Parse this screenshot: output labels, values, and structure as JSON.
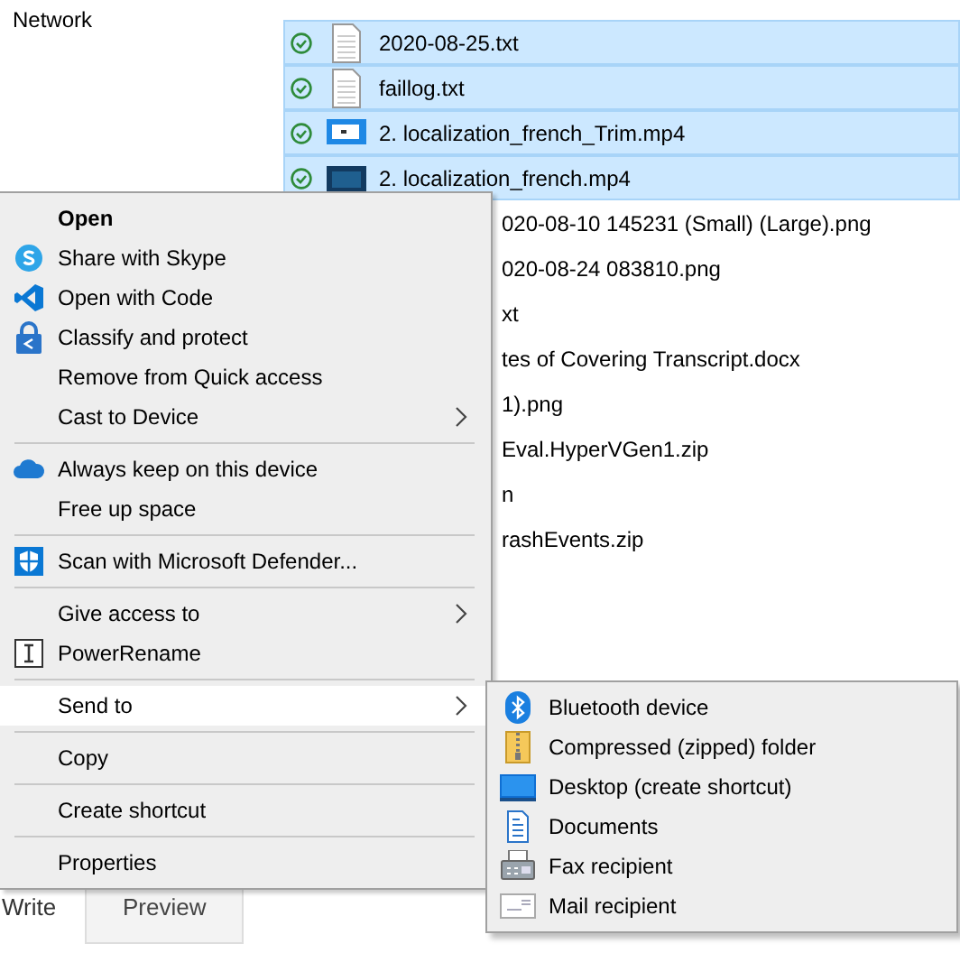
{
  "navigation": {
    "items": [
      {
        "label": "Network"
      }
    ]
  },
  "files": [
    {
      "name": "2020-08-25.txt",
      "kind": "full",
      "selected": true
    },
    {
      "name": "faillog.txt",
      "kind": "full",
      "selected": true
    },
    {
      "name": "2. localization_french_Trim.mp4",
      "kind": "full",
      "selected": true
    },
    {
      "name": "2. localization_french.mp4",
      "kind": "full",
      "selected": true
    },
    {
      "name": "020-08-10 145231 (Small) (Large).png",
      "kind": "partial",
      "selected": false
    },
    {
      "name": "020-08-24 083810.png",
      "kind": "partial",
      "selected": false
    },
    {
      "name": "xt",
      "kind": "partial",
      "selected": false
    },
    {
      "name": "tes of Covering Transcript.docx",
      "kind": "partial",
      "selected": false
    },
    {
      "name": "1).png",
      "kind": "partial",
      "selected": false
    },
    {
      "name": "Eval.HyperVGen1.zip",
      "kind": "partial",
      "selected": false
    },
    {
      "name": "n",
      "kind": "partial",
      "selected": false
    },
    {
      "name": "rashEvents.zip",
      "kind": "partial",
      "selected": false
    }
  ],
  "editor_tabs": [
    {
      "label": "Write",
      "selected": true
    },
    {
      "label": "Preview",
      "selected": false
    }
  ],
  "context_menu": {
    "items": [
      {
        "kind": "item",
        "label": "Open",
        "bold": true,
        "selected": false
      },
      {
        "kind": "item",
        "label": "Share with Skype",
        "selected": false
      },
      {
        "kind": "item",
        "label": "Open with Code",
        "selected": false
      },
      {
        "kind": "item",
        "label": "Classify and protect",
        "selected": false
      },
      {
        "kind": "item",
        "label": "Remove from Quick access",
        "selected": false
      },
      {
        "kind": "item",
        "label": "Cast to Device",
        "submenu": true,
        "selected": false
      },
      {
        "kind": "separator"
      },
      {
        "kind": "item",
        "label": "Always keep on this device",
        "selected": false
      },
      {
        "kind": "item",
        "label": "Free up space",
        "selected": false
      },
      {
        "kind": "separator"
      },
      {
        "kind": "item",
        "label": "Scan with Microsoft Defender...",
        "selected": false
      },
      {
        "kind": "separator"
      },
      {
        "kind": "item",
        "label": "Give access to",
        "submenu": true,
        "selected": false
      },
      {
        "kind": "item",
        "label": "PowerRename",
        "selected": false
      },
      {
        "kind": "separator"
      },
      {
        "kind": "item",
        "label": "Send to",
        "submenu": true,
        "selected": true
      },
      {
        "kind": "separator"
      },
      {
        "kind": "item",
        "label": "Copy",
        "selected": false
      },
      {
        "kind": "separator"
      },
      {
        "kind": "item",
        "label": "Create shortcut",
        "selected": false
      },
      {
        "kind": "separator"
      },
      {
        "kind": "item",
        "label": "Properties",
        "selected": false
      }
    ]
  },
  "send_to_menu": {
    "items": [
      {
        "label": "Bluetooth device"
      },
      {
        "label": "Compressed (zipped) folder"
      },
      {
        "label": "Desktop (create shortcut)"
      },
      {
        "label": "Documents"
      },
      {
        "label": "Fax recipient"
      },
      {
        "label": "Mail recipient"
      }
    ]
  }
}
